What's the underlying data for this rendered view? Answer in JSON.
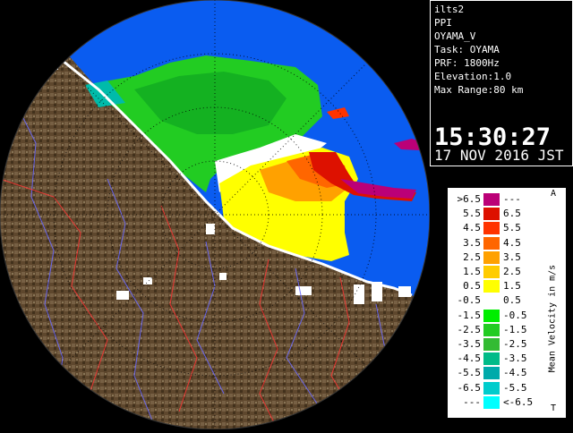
{
  "info": {
    "lines": [
      "ilts2",
      "PPI",
      "OYAMA_V",
      "Task: OYAMA",
      "PRF: 1800Hz",
      "Elevation:1.0",
      "Max Range:80 km"
    ],
    "time": "15:30:27",
    "date": "17 NOV 2016 JST"
  },
  "legend": {
    "title": "Mean Velocity in m/s",
    "top_mark": "A",
    "bottom_mark": "T",
    "rows": [
      {
        "lo": ">6.5",
        "hi": "---",
        "color": "#bb0077"
      },
      {
        "lo": "5.5",
        "hi": "6.5",
        "color": "#dd1100"
      },
      {
        "lo": "4.5",
        "hi": "5.5",
        "color": "#ff3300"
      },
      {
        "lo": "3.5",
        "hi": "4.5",
        "color": "#ff6600"
      },
      {
        "lo": "2.5",
        "hi": "3.5",
        "color": "#ffa100"
      },
      {
        "lo": "1.5",
        "hi": "2.5",
        "color": "#ffcc00"
      },
      {
        "lo": "0.5",
        "hi": "1.5",
        "color": "#ffff00"
      },
      {
        "lo": "-0.5",
        "hi": "0.5",
        "color": "#ffffff"
      },
      {
        "lo": "-1.5",
        "hi": "-0.5",
        "color": "#00ee00"
      },
      {
        "lo": "-2.5",
        "hi": "-1.5",
        "color": "#22cc22"
      },
      {
        "lo": "-3.5",
        "hi": "-2.5",
        "color": "#33bb33"
      },
      {
        "lo": "-4.5",
        "hi": "-3.5",
        "color": "#00bb88"
      },
      {
        "lo": "-5.5",
        "hi": "-4.5",
        "color": "#00aaaa"
      },
      {
        "lo": "-6.5",
        "hi": "-5.5",
        "color": "#00cccc"
      },
      {
        "lo": "---",
        "hi": "<-6.5",
        "color": "#00ffff"
      }
    ]
  },
  "colors": {
    "sea_range": "#0a5cf0",
    "land": "#7a5c3a",
    "coast_line": "#ffffff",
    "river": "#6a6aff",
    "boundary": "#ff3333"
  }
}
